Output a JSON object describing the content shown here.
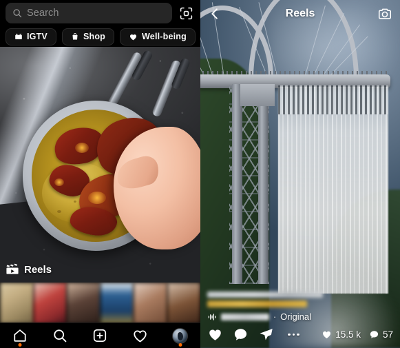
{
  "left_panel": {
    "name": "explore-search-panel",
    "search": {
      "placeholder": "Search",
      "value": "",
      "icon": "search-icon",
      "scan_icon": "qr-scan-icon"
    },
    "chips": [
      {
        "label": "IGTV",
        "icon": "igtv-icon"
      },
      {
        "label": "Shop",
        "icon": "shop-bag-icon"
      },
      {
        "label": "Well-being",
        "icon": "heart-filled-icon"
      },
      {
        "label": "",
        "icon": ""
      }
    ],
    "media": {
      "description": "hand placing dried chilies into a pan of oil on a stainless steel counter",
      "badge_label": "Reels",
      "badge_icon": "reels-clapper-icon"
    },
    "thumbnails": [
      {
        "name": "grid-thumb-1"
      },
      {
        "name": "grid-thumb-2"
      },
      {
        "name": "grid-thumb-3"
      },
      {
        "name": "grid-thumb-4"
      },
      {
        "name": "grid-thumb-5"
      },
      {
        "name": "grid-thumb-6"
      }
    ],
    "bottom_nav": [
      {
        "name": "home",
        "icon": "home-icon",
        "badge_dot": true,
        "badge_color": "#ff6a00"
      },
      {
        "name": "search",
        "icon": "search-icon",
        "badge_dot": false
      },
      {
        "name": "create",
        "icon": "plus-box-icon",
        "badge_dot": false
      },
      {
        "name": "activity",
        "icon": "heart-outline-icon",
        "badge_dot": false
      },
      {
        "name": "profile",
        "icon": "avatar-icon",
        "badge_dot": true,
        "badge_color": "#ff6a00"
      }
    ]
  },
  "right_panel": {
    "name": "reels-viewer-panel",
    "header": {
      "back_icon": "chevron-left-icon",
      "title": "Reels",
      "camera_icon": "camera-outline-icon"
    },
    "media": {
      "description": "tall arch bridge with water cascading off the deck into a gorge"
    },
    "caption": {
      "line_1_redacted": true,
      "line_2_redacted": true
    },
    "audio": {
      "icon": "audio-wave-icon",
      "username_redacted": true,
      "separator": "·",
      "label": "Original"
    },
    "actions": [
      {
        "name": "like",
        "icon": "heart-outline-icon"
      },
      {
        "name": "comment",
        "icon": "comment-bubble-icon"
      },
      {
        "name": "share",
        "icon": "paper-plane-icon"
      },
      {
        "name": "more",
        "icon": "three-dots-icon"
      }
    ],
    "stats": [
      {
        "name": "likes",
        "icon": "heart-filled-icon",
        "value": "15.5 k"
      },
      {
        "name": "comments",
        "icon": "comment-bubble-filled-icon",
        "value": "57"
      }
    ]
  },
  "colors": {
    "background": "#000000",
    "search_field": "#262626",
    "placeholder_text": "#8e8e8e",
    "primary_text": "#fafafa",
    "accent_dot": "#ff6a00"
  }
}
